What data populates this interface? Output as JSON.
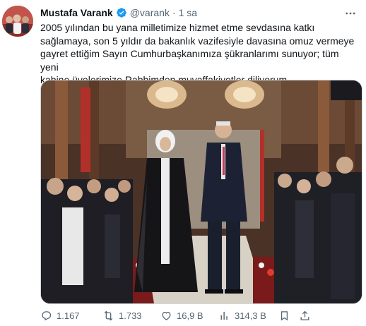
{
  "author": {
    "name": "Mustafa Varank",
    "handle": "@varank",
    "separator": "·",
    "time": "1 sa"
  },
  "tweet": {
    "text": "2005 yılından bu yana milletimize hizmet etme sevdasına katkı\nsağlamaya, son 5 yıldır da bakanlık vazifesiyle davasına omuz vermeye\ngayret ettiğim Sayın Cumhurbaşkanımıza şükranlarımı sunuyor; tüm yeni\nkabine üyelerimize Rabbimden muvaffakiyetler diliyorum."
  },
  "actions": {
    "replies": "1.167",
    "retweets": "1.733",
    "likes": "16,9 B",
    "views": "314,3 B"
  },
  "icons": {
    "verified": "verified-badge-icon",
    "more": "more-options-icon",
    "reply": "reply-icon",
    "retweet": "retweet-icon",
    "like": "heart-icon",
    "views": "views-chart-icon",
    "bookmark": "bookmark-icon",
    "share": "share-icon"
  },
  "colors": {
    "text": "#0f1419",
    "secondary": "#536471",
    "verified": "#1d9bf0"
  }
}
